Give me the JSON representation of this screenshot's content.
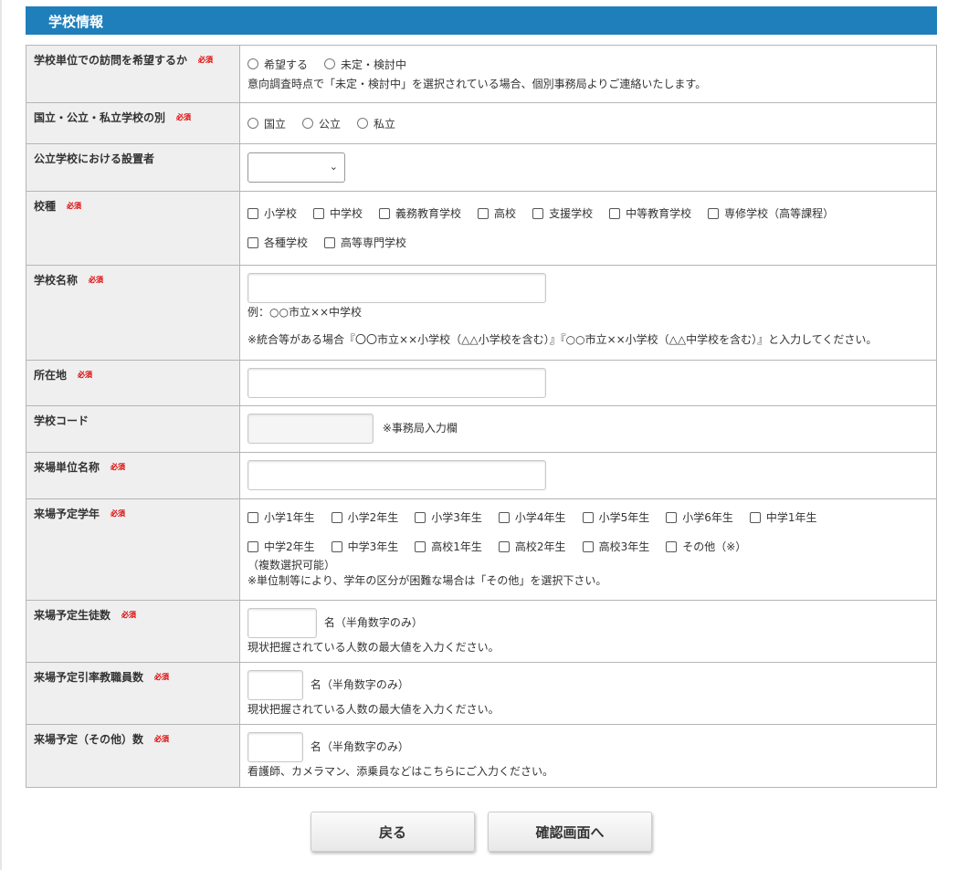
{
  "section_title": "学校情報",
  "required_label": "必須",
  "rows": {
    "visit": {
      "label": "学校単位での訪問を希望するか",
      "options": [
        "希望する",
        "未定・検討中"
      ],
      "note": "意向調査時点で「未定・検討中」を選択されている場合、個別事務局よりご連絡いたします。"
    },
    "type": {
      "label": "国立・公立・私立学校の別",
      "options": [
        "国立",
        "公立",
        "私立"
      ]
    },
    "founder": {
      "label": "公立学校における設置者",
      "value": ""
    },
    "kind": {
      "label": "校種",
      "options": [
        "小学校",
        "中学校",
        "義務教育学校",
        "高校",
        "支援学校",
        "中等教育学校",
        "専修学校（高等課程）",
        "各種学校",
        "高等専門学校"
      ]
    },
    "name": {
      "label": "学校名称",
      "value": "",
      "example": "例：○○市立××中学校",
      "note": "※統合等がある場合『〇〇市立××小学校（△△小学校を含む）』『○○市立××小学校（△△中学校を含む）』と入力してください。"
    },
    "address": {
      "label": "所在地",
      "value": ""
    },
    "code": {
      "label": "学校コード",
      "value": "",
      "note": "※事務局入力欄"
    },
    "unit": {
      "label": "来場単位名称",
      "value": ""
    },
    "grades": {
      "label": "来場予定学年",
      "options": [
        "小学1年生",
        "小学2年生",
        "小学3年生",
        "小学4年生",
        "小学5年生",
        "小学6年生",
        "中学1年生",
        "中学2年生",
        "中学3年生",
        "高校1年生",
        "高校2年生",
        "高校3年生",
        "その他（※）"
      ],
      "note1": "（複数選択可能）",
      "note2": "※単位制等により、学年の区分が困難な場合は「その他」を選択下さい。"
    },
    "students": {
      "label": "来場予定生徒数",
      "value": "",
      "unit": "名（半角数字のみ）",
      "note": "現状把握されている人数の最大値を入力ください。"
    },
    "teachers": {
      "label": "来場予定引率教職員数",
      "value": "",
      "unit": "名（半角数字のみ）",
      "note": "現状把握されている人数の最大値を入力ください。"
    },
    "others": {
      "label": "来場予定（その他）数",
      "value": "",
      "unit": "名（半角数字のみ）",
      "note": "看護師、カメラマン、添乗員などはこちらにご入力ください。"
    }
  },
  "buttons": {
    "back": "戻る",
    "confirm": "確認画面へ"
  }
}
